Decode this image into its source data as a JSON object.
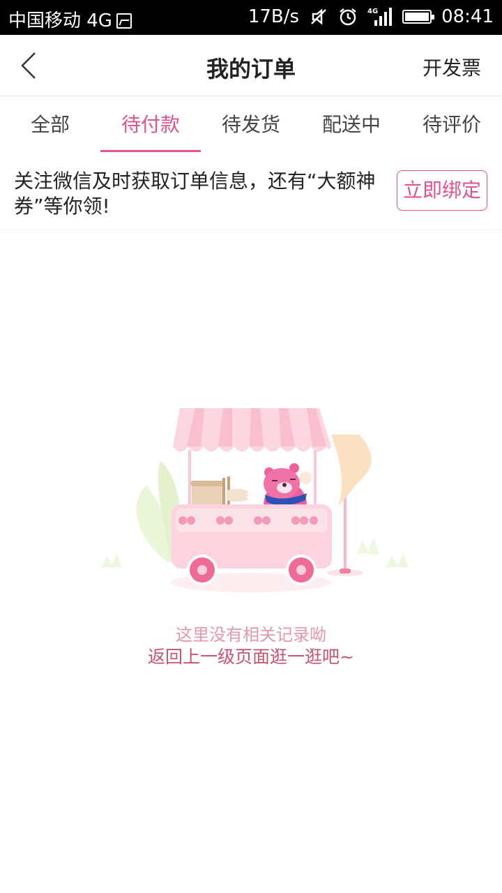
{
  "status_bar": {
    "carrier": "中国移动 4G",
    "speed": "17B/s",
    "time": "08:41",
    "icons": [
      "image-icon",
      "mute-icon",
      "alarm-icon",
      "signal-4g-icon",
      "battery-icon"
    ]
  },
  "nav": {
    "back_icon": "chevron-left-icon",
    "title": "我的订单",
    "invoice_label": "开发票"
  },
  "tabs": [
    {
      "label": "全部"
    },
    {
      "label": "待付款",
      "active": true
    },
    {
      "label": "待发货"
    },
    {
      "label": "配送中"
    },
    {
      "label": "待评价"
    }
  ],
  "banner": {
    "text": "关注微信及时获取订单信息，还有“大额神券”等你领!",
    "button_label": "立即绑定"
  },
  "empty_state": {
    "illustration": "food-cart-bear-illustration",
    "message": "这里没有相关记录呦",
    "action": "返回上一级页面逛一逛吧~"
  },
  "colors": {
    "accent": "#e5508e",
    "empty_message": "#e497ad",
    "empty_action": "#c7536f"
  }
}
